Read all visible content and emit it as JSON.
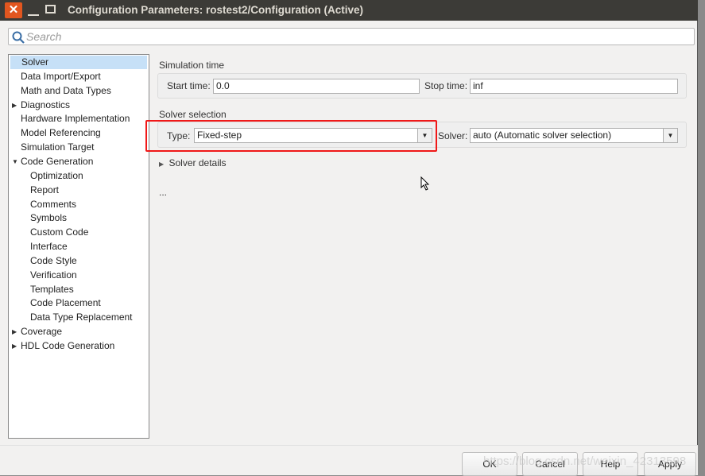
{
  "window": {
    "title": "Configuration Parameters: rostest2/Configuration (Active)"
  },
  "search": {
    "placeholder": "Search",
    "value": ""
  },
  "tree": {
    "items": [
      {
        "label": "Solver",
        "level": 0,
        "selected": true
      },
      {
        "label": "Data Import/Export",
        "level": 0
      },
      {
        "label": "Math and Data Types",
        "level": 0
      },
      {
        "label": "Diagnostics",
        "level": 0,
        "expander": "collapsed"
      },
      {
        "label": "Hardware Implementation",
        "level": 0
      },
      {
        "label": "Model Referencing",
        "level": 0
      },
      {
        "label": "Simulation Target",
        "level": 0
      },
      {
        "label": "Code Generation",
        "level": 0,
        "expander": "expanded"
      },
      {
        "label": "Optimization",
        "level": 1
      },
      {
        "label": "Report",
        "level": 1
      },
      {
        "label": "Comments",
        "level": 1
      },
      {
        "label": "Symbols",
        "level": 1
      },
      {
        "label": "Custom Code",
        "level": 1
      },
      {
        "label": "Interface",
        "level": 1
      },
      {
        "label": "Code Style",
        "level": 1
      },
      {
        "label": "Verification",
        "level": 1
      },
      {
        "label": "Templates",
        "level": 1
      },
      {
        "label": "Code Placement",
        "level": 1
      },
      {
        "label": "Data Type Replacement",
        "level": 1
      },
      {
        "label": "Coverage",
        "level": 0,
        "expander": "collapsed"
      },
      {
        "label": "HDL Code Generation",
        "level": 0,
        "expander": "collapsed"
      }
    ]
  },
  "main": {
    "simulation_time": {
      "heading": "Simulation time",
      "start_label": "Start time:",
      "start_value": "0.0",
      "stop_label": "Stop time:",
      "stop_value": "inf"
    },
    "solver_selection": {
      "heading": "Solver selection",
      "type_label": "Type:",
      "type_value": "Fixed-step",
      "solver_label": "Solver:",
      "solver_value": "auto (Automatic solver selection)"
    },
    "solver_details": "Solver details",
    "ellipsis": "..."
  },
  "buttons": {
    "ok": "OK",
    "cancel": "Cancel",
    "help": "Help",
    "apply": "Apply"
  },
  "watermark": "https://blog.csdn.net/weixin_42313598",
  "colors": {
    "highlight": "#f01818",
    "selection": "#c6e0f7",
    "titlebar": "#3c3b37",
    "close": "#e2561f"
  }
}
